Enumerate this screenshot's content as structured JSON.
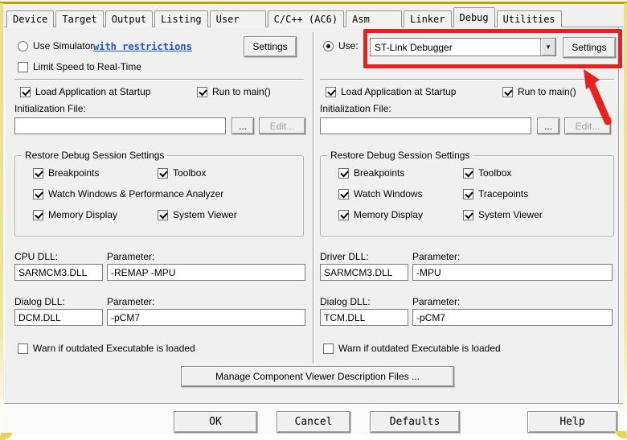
{
  "tabs": {
    "items": [
      "Device",
      "Target",
      "Output",
      "Listing",
      "User",
      "C/C++ (AC6)",
      "Asm",
      "Linker",
      "Debug",
      "Utilities"
    ],
    "active": "Debug"
  },
  "left": {
    "use_simulator": {
      "label": "Use Simulator",
      "checked": false
    },
    "restrictions_link": "with restrictions",
    "settings_button": "Settings",
    "limit_speed": {
      "label": "Limit Speed to Real-Time",
      "checked": false
    },
    "load_app": {
      "label": "Load Application at Startup",
      "checked": true
    },
    "run_to_main": {
      "label": "Run to main()",
      "checked": true
    },
    "init_file": {
      "label": "Initialization File:",
      "value": "",
      "browse": "...",
      "edit": "Edit..."
    },
    "session": {
      "title": "Restore Debug Session Settings",
      "breakpoints": {
        "label": "Breakpoints",
        "checked": true
      },
      "toolbox": {
        "label": "Toolbox",
        "checked": true
      },
      "watch": {
        "label": "Watch Windows & Performance Analyzer",
        "checked": true
      },
      "memory": {
        "label": "Memory Display",
        "checked": true
      },
      "system": {
        "label": "System Viewer",
        "checked": true
      }
    },
    "cpu_dll": {
      "label": "CPU DLL:",
      "value": "SARMCM3.DLL",
      "param_label": "Parameter:",
      "param_value": "-REMAP -MPU"
    },
    "dialog_dll": {
      "label": "Dialog DLL:",
      "value": "DCM.DLL",
      "param_label": "Parameter:",
      "param_value": "-pCM7"
    },
    "warn": {
      "label": "Warn if outdated Executable is loaded",
      "checked": false
    }
  },
  "right": {
    "use": {
      "label": "Use:",
      "checked": true
    },
    "driver": {
      "value": "ST-Link Debugger"
    },
    "settings_button": "Settings",
    "load_app": {
      "label": "Load Application at Startup",
      "checked": true
    },
    "run_to_main": {
      "label": "Run to main()",
      "checked": true
    },
    "init_file": {
      "label": "Initialization File:",
      "value": "",
      "browse": "...",
      "edit": "Edit..."
    },
    "session": {
      "title": "Restore Debug Session Settings",
      "breakpoints": {
        "label": "Breakpoints",
        "checked": true
      },
      "toolbox": {
        "label": "Toolbox",
        "checked": true
      },
      "watch": {
        "label": "Watch Windows",
        "checked": true
      },
      "trace": {
        "label": "Tracepoints",
        "checked": true
      },
      "memory": {
        "label": "Memory Display",
        "checked": true
      },
      "system": {
        "label": "System Viewer",
        "checked": true
      }
    },
    "driver_dll": {
      "label": "Driver DLL:",
      "value": "SARMCM3.DLL",
      "param_label": "Parameter:",
      "param_value": "-MPU"
    },
    "dialog_dll": {
      "label": "Dialog DLL:",
      "value": "TCM.DLL",
      "param_label": "Parameter:",
      "param_value": "-pCM7"
    },
    "warn": {
      "label": "Warn if outdated Executable is loaded",
      "checked": false
    }
  },
  "footer": {
    "manage_button": "Manage Component Viewer Description Files ...",
    "ok": "OK",
    "cancel": "Cancel",
    "defaults": "Defaults",
    "help": "Help"
  },
  "icons": {
    "combo_dropdown": "dropdown-arrow-icon",
    "annotation": "red-highlight-box-and-arrow"
  },
  "colors": {
    "annotation_red": "#e8211d",
    "link_blue": "#2257c4",
    "frame_yellow": "#bfa207",
    "dialog_bg": "#f0f0f0"
  }
}
